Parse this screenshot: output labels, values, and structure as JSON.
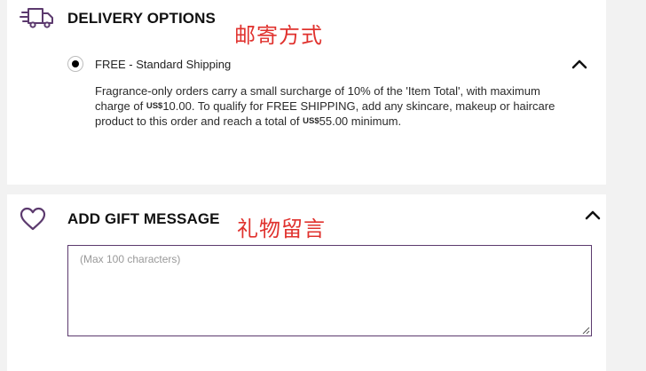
{
  "delivery": {
    "title": "DELIVERY OPTIONS",
    "annotation": "邮寄方式",
    "icon": "truck-icon",
    "option": {
      "label": "FREE - Standard Shipping",
      "selected": true,
      "desc_part1": "Fragrance-only orders carry a small surcharge of 10% of the 'Item Total', with maximum charge of ",
      "currency1": "US$",
      "amount1": "10.00",
      "desc_part2": ". To qualify for FREE SHIPPING, add any skincare, makeup or haircare product to this order and reach a total of ",
      "currency2": "US$",
      "amount2": "55.00",
      "desc_part3": " minimum."
    },
    "chevron_icon": "chevron-up-icon"
  },
  "gift": {
    "title": "ADD GIFT MESSAGE",
    "annotation": "礼物留言",
    "icon": "heart-icon",
    "placeholder": "(Max 100 characters)",
    "chevron_icon": "chevron-up-icon"
  },
  "colors": {
    "accent_purple": "#5c3a6e",
    "annotation_red": "#e0322e",
    "page_bg": "#f2f2f2"
  }
}
